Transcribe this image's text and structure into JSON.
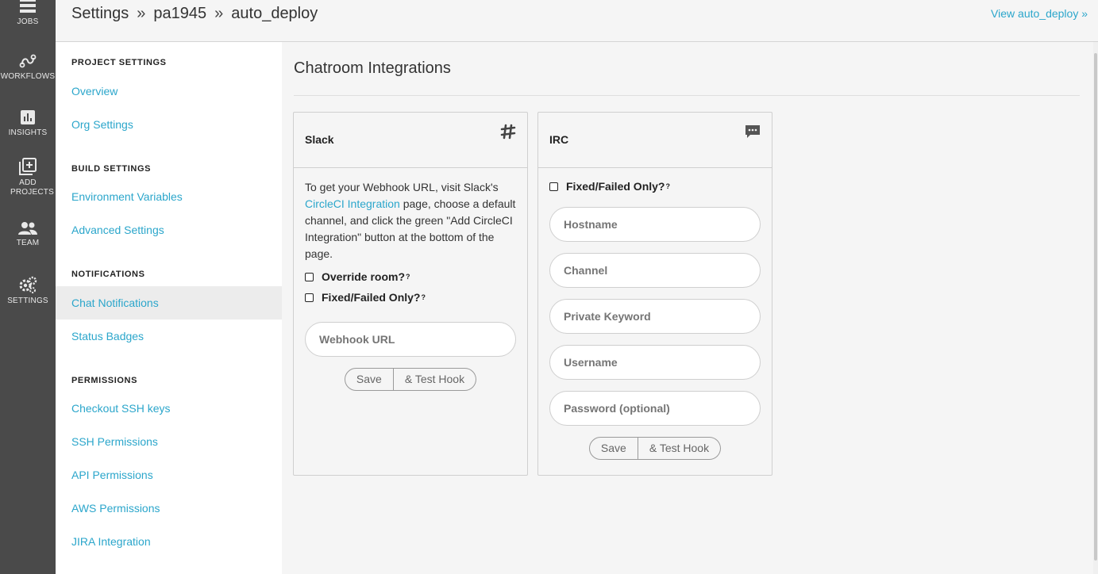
{
  "rail": {
    "items": [
      {
        "label": "JOBS",
        "icon": "jobs-icon"
      },
      {
        "label": "WORKFLOWS",
        "icon": "workflows-icon"
      },
      {
        "label": "INSIGHTS",
        "icon": "insights-icon"
      },
      {
        "label": "ADD PROJECTS",
        "icon": "add-projects-icon"
      },
      {
        "label": "TEAM",
        "icon": "team-icon"
      },
      {
        "label": "SETTINGS",
        "icon": "settings-icon"
      }
    ]
  },
  "header": {
    "crumb_root": "Settings",
    "sep": "»",
    "crumb_org": "pa1945",
    "crumb_project": "auto_deploy",
    "view_link": "View auto_deploy »"
  },
  "nav": {
    "project_settings": "PROJECT SETTINGS",
    "overview": "Overview",
    "org_settings": "Org Settings",
    "build_settings": "BUILD SETTINGS",
    "env_vars": "Environment Variables",
    "advanced": "Advanced Settings",
    "notifications": "NOTIFICATIONS",
    "chat_notifications": "Chat Notifications",
    "status_badges": "Status Badges",
    "permissions": "PERMISSIONS",
    "checkout_ssh": "Checkout SSH keys",
    "ssh_permissions": "SSH Permissions",
    "api_permissions": "API Permissions",
    "aws_permissions": "AWS Permissions",
    "jira": "JIRA Integration"
  },
  "main": {
    "title": "Chatroom Integrations"
  },
  "slack": {
    "title": "Slack",
    "desc_before": "To get your Webhook URL, visit Slack's ",
    "desc_link": "CircleCI Integration",
    "desc_after": " page, choose a default channel, and click the green \"Add CircleCI Integration\" button at the bottom of the page.",
    "override_room": "Override room?",
    "fixed_failed": "Fixed/Failed Only?",
    "help_mark": "?",
    "webhook_placeholder": "Webhook URL",
    "save": "Save",
    "test_hook": "& Test Hook"
  },
  "irc": {
    "title": "IRC",
    "fixed_failed": "Fixed/Failed Only?",
    "help_mark": "?",
    "hostname_placeholder": "Hostname",
    "channel_placeholder": "Channel",
    "keyword_placeholder": "Private Keyword",
    "username_placeholder": "Username",
    "password_placeholder": "Password (optional)",
    "save": "Save",
    "test_hook": "& Test Hook"
  },
  "colors": {
    "rail_bg": "#4a4a4a",
    "link": "#2ba6cb",
    "active_nav_bg": "#ececec"
  }
}
